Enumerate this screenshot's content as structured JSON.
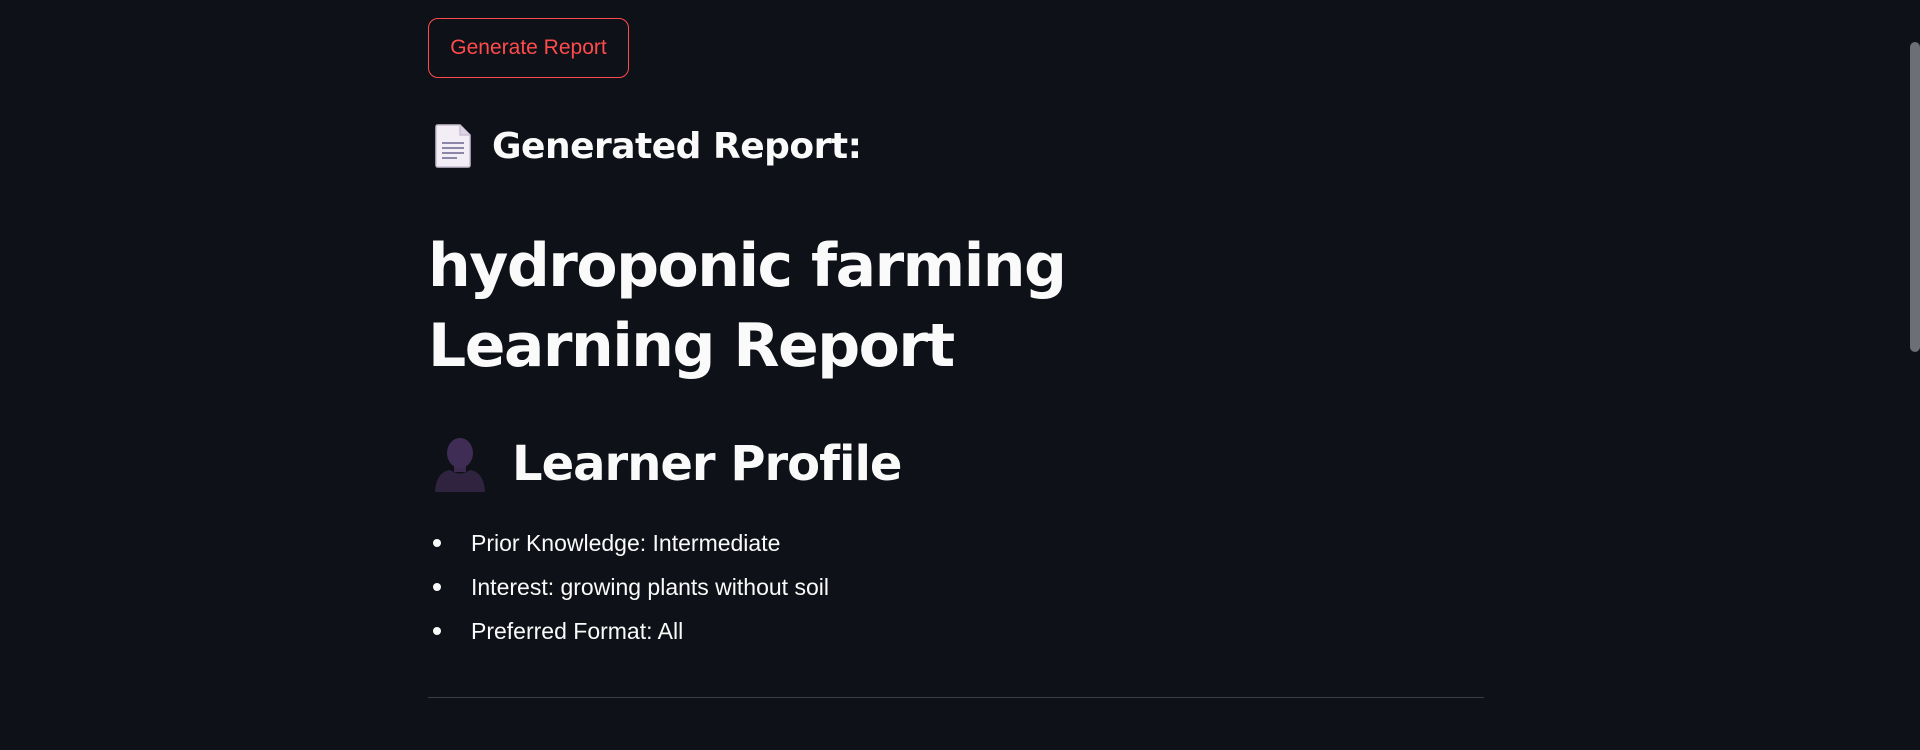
{
  "toolbar": {
    "generate_button_label": "Generate Report"
  },
  "report": {
    "heading": "Generated Report:",
    "heading_icon": "page-facing-up-icon",
    "title": "hydroponic farming Learning Report"
  },
  "learner_profile": {
    "heading": "Learner Profile",
    "heading_icon": "bust-in-silhouette-icon",
    "items": [
      {
        "label": "Prior Knowledge: Intermediate"
      },
      {
        "label": "Interest: growing plants without soil"
      },
      {
        "label": "Preferred Format: All"
      }
    ]
  },
  "colors": {
    "background": "#0e1117",
    "text": "#fafafa",
    "accent": "#ff4b4b",
    "divider": "#3b3e46"
  }
}
